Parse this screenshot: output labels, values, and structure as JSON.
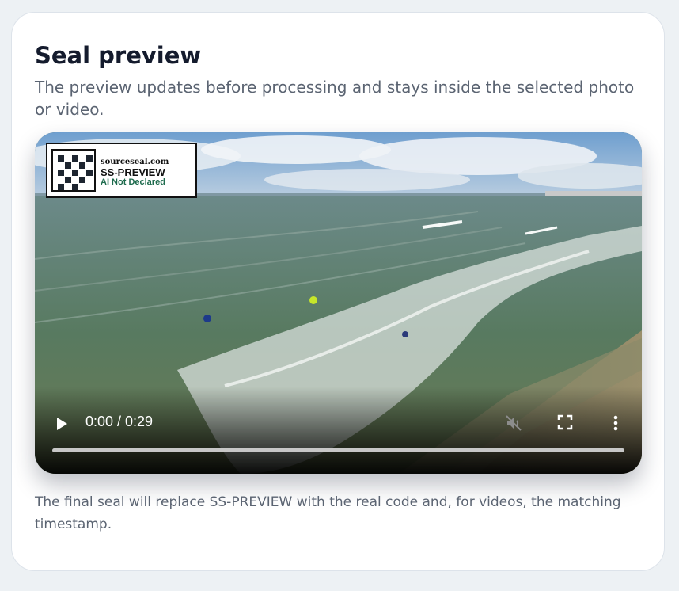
{
  "card": {
    "title": "Seal preview",
    "subtitle": "The preview updates before processing and stays inside the selected photo or video.",
    "footnote": "The final seal will replace SS-PREVIEW with the real code and, for videos, the matching timestamp."
  },
  "seal": {
    "domain": "sourceseal.com",
    "code": "SS-PREVIEW",
    "status": "AI Not Declared"
  },
  "player": {
    "time": "0:00 / 0:29",
    "progress": 0,
    "muted": true,
    "icons": [
      "play-icon",
      "muted-speaker-icon",
      "fullscreen-icon",
      "more-vertical-icon"
    ]
  },
  "colors": {
    "title": "#141b2d",
    "text": "#5b6472",
    "seal_status": "#1e6b4d"
  }
}
